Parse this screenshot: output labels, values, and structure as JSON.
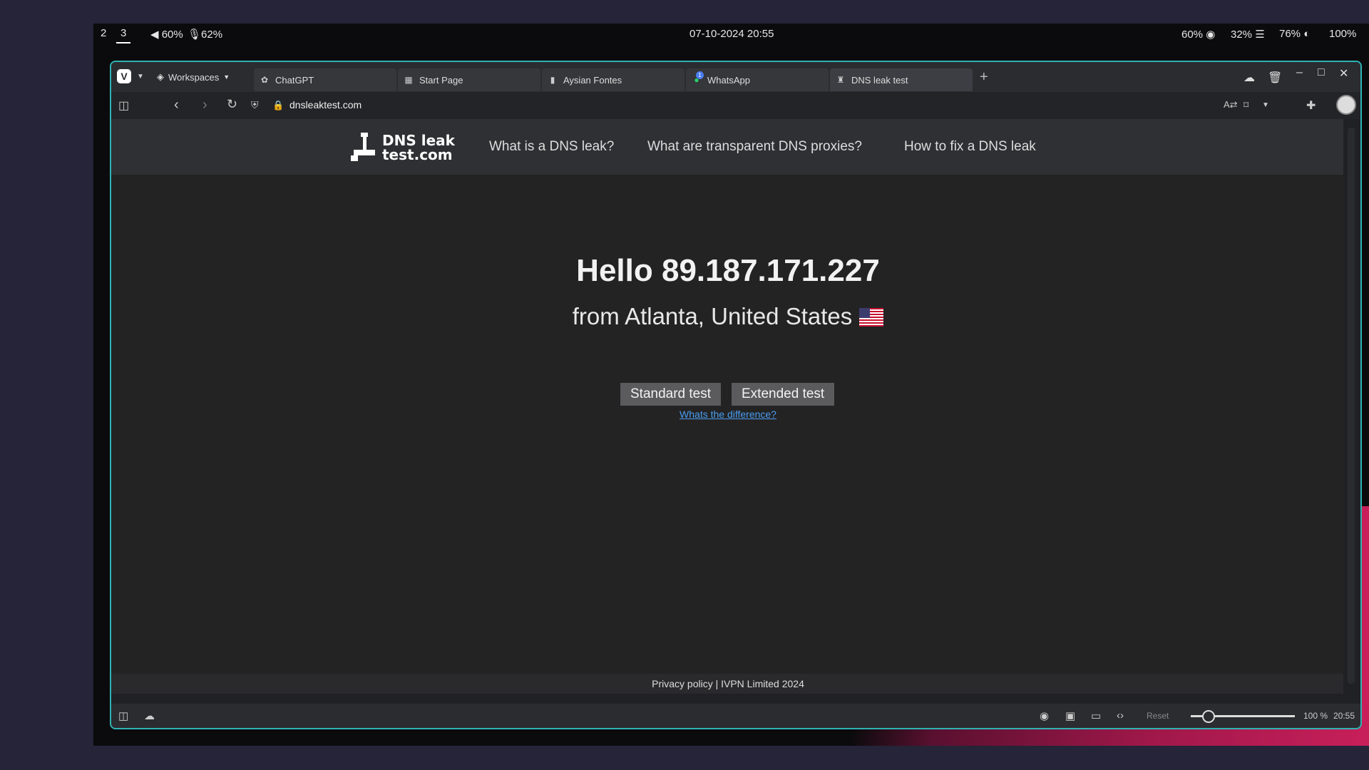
{
  "system_bar": {
    "workspace_2": "2",
    "workspace_3": "3",
    "volume": "60%",
    "mic": "62%",
    "datetime": "07-10-2024 20:55",
    "cpu": "60%",
    "mem": "32%",
    "brightness": "76%",
    "battery": "100%"
  },
  "browser": {
    "workspaces_label": "Workspaces",
    "tabs": [
      {
        "label": "ChatGPT",
        "icon": "chatgpt-icon"
      },
      {
        "label": "Start Page",
        "icon": "grid-icon"
      },
      {
        "label": "Aysian Fontes",
        "icon": "doc-icon"
      },
      {
        "label": "WhatsApp",
        "icon": "whatsapp-icon",
        "badge": "1"
      },
      {
        "label": "DNS leak test",
        "icon": "dns-icon",
        "active": true
      }
    ],
    "url": "dnsleaktest.com",
    "zoom_reset": "Reset",
    "zoom_level": "100 %",
    "clock": "20:55"
  },
  "site": {
    "logo_line1": "DNS leak",
    "logo_line2": "test.com",
    "nav": [
      "What is a DNS leak?",
      "What are transparent DNS proxies?",
      "How to fix a DNS leak"
    ],
    "hello": "Hello 89.187.171.227",
    "from": "from Atlanta, United States",
    "standard_test": "Standard test",
    "extended_test": "Extended test",
    "difference_link": "Whats the difference?",
    "footer": "Privacy policy | IVPN Limited 2024"
  }
}
